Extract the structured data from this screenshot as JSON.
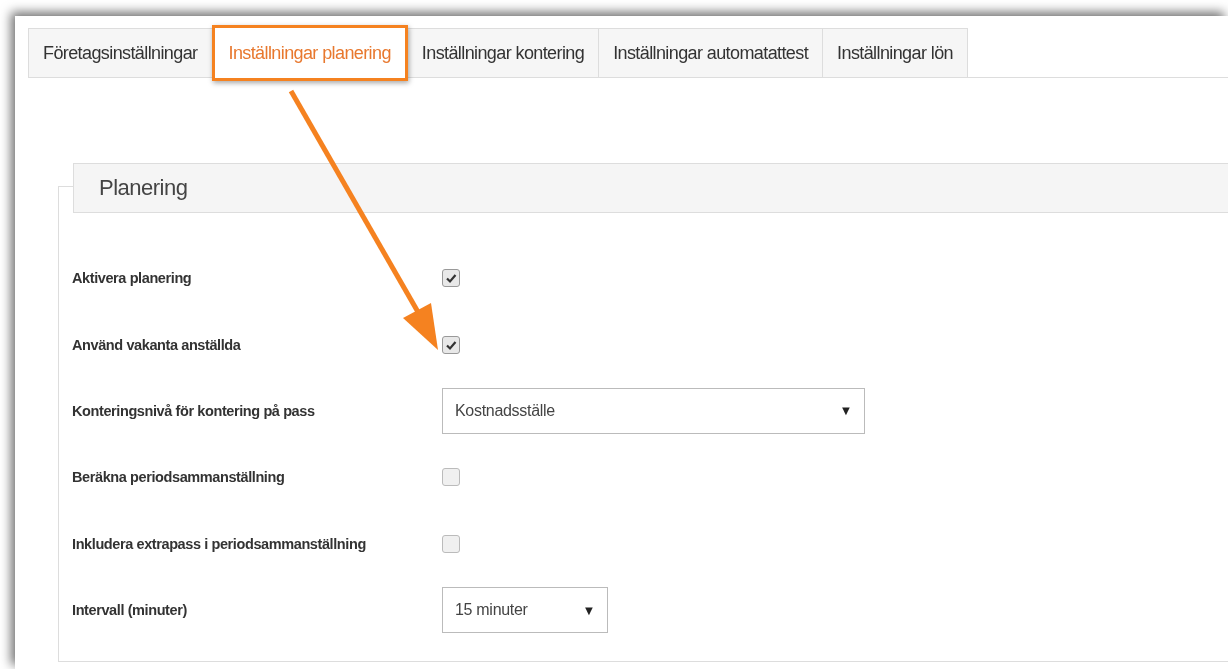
{
  "tabs": [
    {
      "label": "Företagsinställningar",
      "selected": false
    },
    {
      "label": "Inställningar planering",
      "selected": true
    },
    {
      "label": "Inställningar kontering",
      "selected": false
    },
    {
      "label": "Inställningar automatattest",
      "selected": false
    },
    {
      "label": "Inställningar lön",
      "selected": false
    }
  ],
  "section": {
    "title": "Planering"
  },
  "settings": [
    {
      "kind": "checkbox",
      "label": "Aktivera planering",
      "checked": true
    },
    {
      "kind": "checkbox",
      "label": "Använd vakanta anställda",
      "checked": true
    },
    {
      "kind": "select",
      "label": "Konteringsnivå för kontering på pass",
      "value": "Kostnadsställe",
      "caret": "▼"
    },
    {
      "kind": "checkbox",
      "label": "Beräkna periodsammanställning",
      "checked": false
    },
    {
      "kind": "checkbox",
      "label": "Inkludera extrapass i periodsammanställning",
      "checked": false
    },
    {
      "kind": "select",
      "label": "Intervall (minuter)",
      "value": "15 minuter",
      "caret": "▼"
    }
  ]
}
